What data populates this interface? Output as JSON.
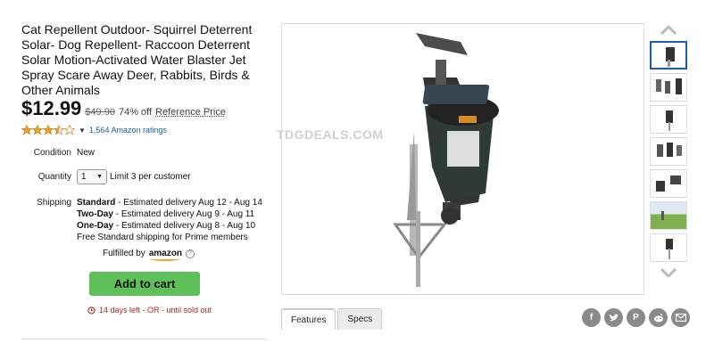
{
  "product": {
    "title": "Cat Repellent Outdoor- Squirrel Deterrent Solar- Dog Repellent- Raccoon Deterrent Solar Motion-Activated Water Blaster Jet Spray Scare Away Deer, Rabbits, Birds & Other Animals",
    "price": "$12.99",
    "old_price": "$49.90",
    "discount": "74% off",
    "reference_price": "Reference Price",
    "rating_stars": 3.5,
    "ratings_link": "1,564 Amazon ratings"
  },
  "details": {
    "condition_label": "Condition",
    "condition_value": "New",
    "quantity_label": "Quantity",
    "quantity_value": "1",
    "quantity_limit": "Limit 3 per customer",
    "shipping_label": "Shipping",
    "shipping_lines": [
      {
        "bold": "Standard",
        "text": " - Estimated delivery Aug 12 - Aug 14"
      },
      {
        "bold": "Two-Day",
        "text": " - Estimated delivery Aug 9 - Aug 11"
      },
      {
        "bold": "One-Day",
        "text": " - Estimated delivery Aug 8 - Aug 10"
      },
      {
        "bold": "",
        "text": "Free Standard shipping for Prime members"
      }
    ],
    "fulfilled_by": "Fulfilled by",
    "fulfiller_logo_text": "amazon"
  },
  "actions": {
    "add_to_cart": "Add to cart",
    "stock_notice": "14 days left - OR - until sold out"
  },
  "gallery": {
    "watermark": "TDGDEALS.COM",
    "thumbnail_count": 7,
    "active_thumbnail": 0
  },
  "tabs": [
    {
      "label": "Features",
      "active": true
    },
    {
      "label": "Specs",
      "active": false
    }
  ],
  "social_icons": [
    "facebook-icon",
    "twitter-icon",
    "pinterest-icon",
    "reddit-icon",
    "email-icon"
  ],
  "colors": {
    "cart_button": "#5fc05a",
    "link": "#1a5ea8",
    "stock_warning": "#b0242c",
    "star": "#f0a030"
  }
}
